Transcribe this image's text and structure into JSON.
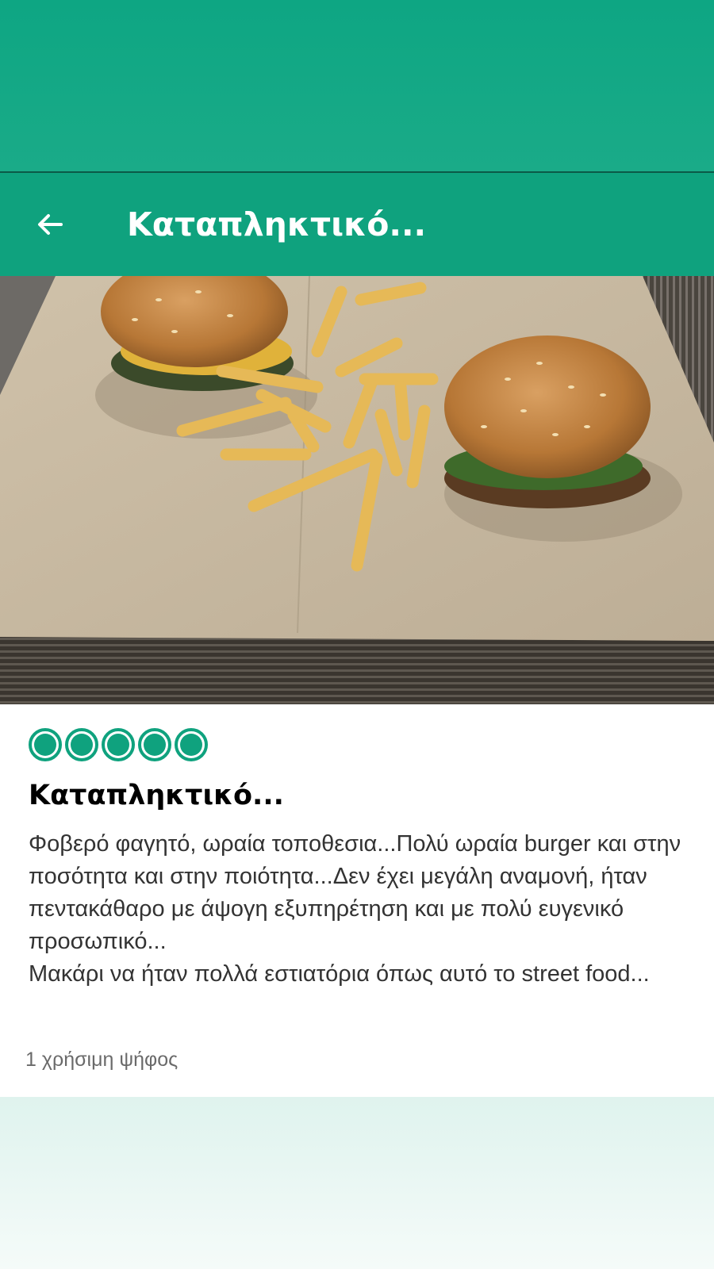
{
  "header": {
    "title": "Καταπληκτικό...",
    "back_icon": "arrow-left-icon",
    "background_color": "#0fa27e"
  },
  "photo": {
    "description_icon": "burger-and-fries-photo"
  },
  "review": {
    "rating": 5,
    "rating_max": 5,
    "rating_color": "#0fa27e",
    "title": "Καταπληκτικό...",
    "body_paragraph_1": "Φοβερό φαγητό, ωραία τοποθεσια...Πολύ ωραία burger και στην ποσότητα και στην ποιότητα...Δεν έχει μεγάλη αναμονή, ήταν πεντακάθαρο με άψογη εξυπηρέτηση και με πολύ ευγενικό προσωπικό...",
    "body_paragraph_2": "Μακάρι να ήταν πολλά εστιατόρια όπως αυτό το street food...",
    "helpful_votes": "1 χρήσιμη ψήφος"
  }
}
